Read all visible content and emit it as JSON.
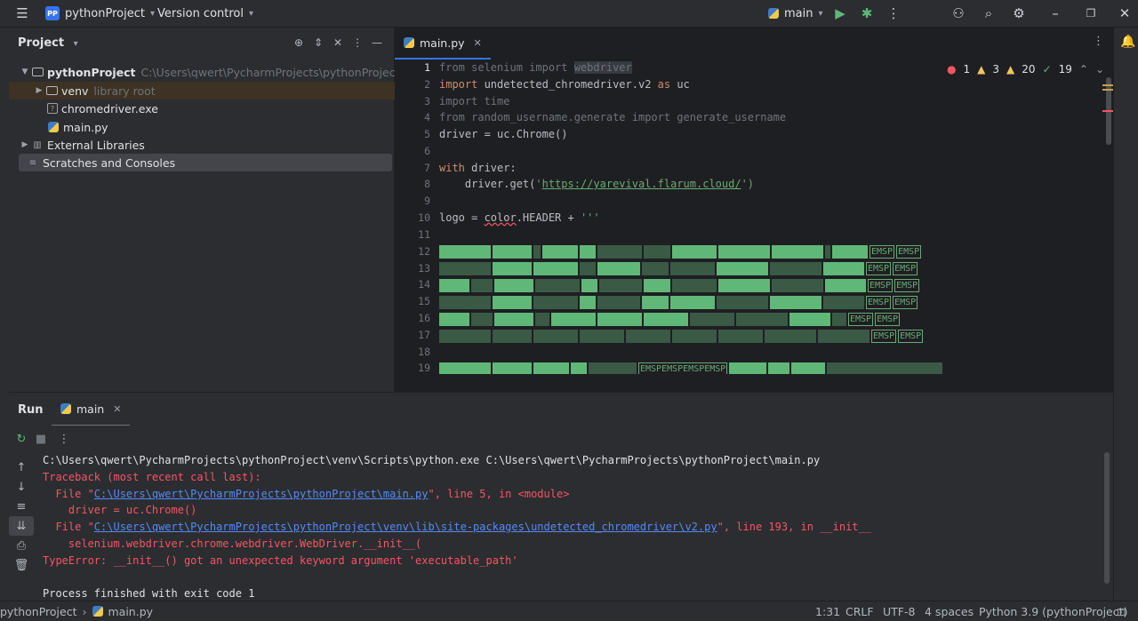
{
  "titlebar": {
    "project_badge": "PP",
    "project_name": "pythonProject",
    "vcs": "Version control",
    "run_config": "main"
  },
  "project_panel": {
    "title": "Project",
    "tree": [
      {
        "label": "pythonProject",
        "hint": "C:\\Users\\qwert\\PycharmProjects\\pythonProject"
      },
      {
        "label": "venv",
        "hint": "library root"
      },
      {
        "label": "chromedriver.exe"
      },
      {
        "label": "main.py"
      },
      {
        "label": "External Libraries"
      },
      {
        "label": "Scratches and Consoles"
      }
    ]
  },
  "editor": {
    "tab": "main.py",
    "inspections": {
      "errors": "1",
      "warnings": "3",
      "weak": "20",
      "ok": "19"
    },
    "line_numbers": [
      "1",
      "2",
      "3",
      "4",
      "5",
      "6",
      "7",
      "8",
      "9",
      "10",
      "11",
      "12",
      "13",
      "14",
      "15",
      "16",
      "17",
      "18",
      "19"
    ],
    "code": {
      "l1a": "from selenium import ",
      "l1b": "webdriver",
      "l2a": "import",
      "l2b": " undetected_chromedriver.v2 ",
      "l2c": "as",
      "l2d": " uc",
      "l3": "import time",
      "l4": "from random_username.generate import generate_username",
      "l5": "driver = uc.Chrome()",
      "l7a": "with",
      "l7b": " driver:",
      "l8a": "    driver.get(",
      "l8b": "'",
      "l8c": "https://yarevival.flarum.cloud/",
      "l8d": "')",
      "l10a": "logo = ",
      "l10b": "color",
      "l10c": ".HEADER + ",
      "l10d": "'''",
      "emsp": "EMSP",
      "emsp_row19": "EMSPEMSPEMSPEMSP"
    }
  },
  "run_panel": {
    "title": "Run",
    "tab": "main",
    "console": {
      "l1": "C:\\Users\\qwert\\PycharmProjects\\pythonProject\\venv\\Scripts\\python.exe C:\\Users\\qwert\\PycharmProjects\\pythonProject\\main.py",
      "l2": "Traceback (most recent call last):",
      "l3a": "  File \"",
      "l3b": "C:\\Users\\qwert\\PycharmProjects\\pythonProject\\main.py",
      "l3c": "\", line 5, in <module>",
      "l4": "    driver = uc.Chrome()",
      "l5a": "  File \"",
      "l5b": "C:\\Users\\qwert\\PycharmProjects\\pythonProject\\venv\\lib\\site-packages\\undetected_chromedriver\\v2.py",
      "l5c": "\", line 193, in __init__",
      "l6": "    selenium.webdriver.chrome.webdriver.WebDriver.__init__(",
      "l7": "TypeError: __init__() got an unexpected keyword argument 'executable_path'",
      "l9": "Process finished with exit code 1"
    }
  },
  "statusbar": {
    "crumb1": "pythonProject",
    "crumb2": "main.py",
    "position": "1:31",
    "line_sep": "CRLF",
    "encoding": "UTF-8",
    "indent": "4 spaces",
    "interpreter": "Python 3.9 (pythonProject)"
  },
  "colors": {
    "accent": "#3574f0",
    "error": "#f75464",
    "string": "#6aab73",
    "keyword": "#cf8e6d"
  }
}
